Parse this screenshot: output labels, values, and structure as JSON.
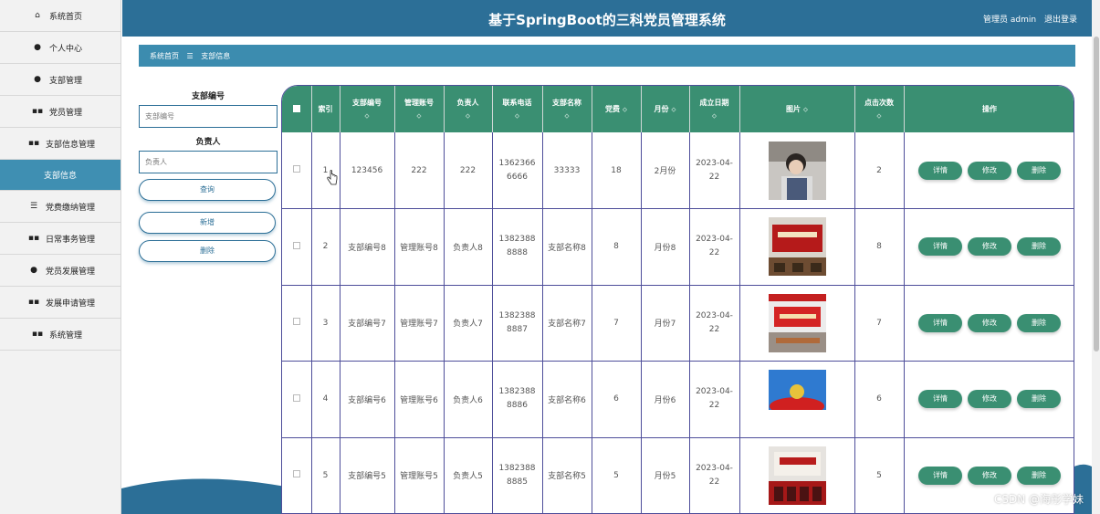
{
  "sidebar": {
    "items": [
      {
        "icon": "home-icon",
        "glyph": "⌂",
        "label": "系统首页"
      },
      {
        "icon": "user-icon",
        "glyph": "●",
        "label": "个人中心"
      },
      {
        "icon": "user-icon",
        "glyph": "●",
        "label": "支部管理"
      },
      {
        "icon": "grid-icon",
        "glyph": "▪▪",
        "label": "党员管理"
      },
      {
        "icon": "grid-icon",
        "glyph": "▪▪",
        "label": "支部信息管理"
      },
      {
        "icon": "",
        "glyph": "",
        "label": "支部信息"
      },
      {
        "icon": "list-icon",
        "glyph": "☰",
        "label": "党费缴纳管理"
      },
      {
        "icon": "grid-icon",
        "glyph": "▪▪",
        "label": "日常事务管理"
      },
      {
        "icon": "pin-icon",
        "glyph": "●",
        "label": "党员发展管理"
      },
      {
        "icon": "grid-icon",
        "glyph": "▪▪",
        "label": "发展申请管理"
      },
      {
        "icon": "grid-icon",
        "glyph": "▪▪",
        "label": "系统管理"
      }
    ]
  },
  "header": {
    "title": "基于SpringBoot的三科党员管理系统",
    "user": "管理员 admin",
    "logout": "退出登录"
  },
  "breadcrumb": {
    "home": "系统首页",
    "sep": "☰",
    "current": "支部信息"
  },
  "search": {
    "field1_label": "支部编号",
    "field1_placeholder": "支部编号",
    "field2_label": "负责人",
    "field2_placeholder": "负责人",
    "query": "查询",
    "add": "新增",
    "delete": "删除"
  },
  "table": {
    "headers": [
      "索引",
      "支部编号",
      "管理账号",
      "负责人",
      "联系电话",
      "支部名称",
      "党费",
      "月份",
      "成立日期",
      "图片",
      "点击次数",
      "操作"
    ],
    "sort_glyph": "⬦",
    "row_buttons": {
      "detail": "详情",
      "edit": "修改",
      "delete": "删除"
    },
    "rows": [
      {
        "index": "1",
        "code": "123456",
        "account": "222",
        "leader": "222",
        "phone": "1362366 6666",
        "name": "33333",
        "fee": "18",
        "month": "2月份",
        "date": "2023-04-22",
        "clicks": "2"
      },
      {
        "index": "2",
        "code": "支部编号8",
        "account": "管理账号8",
        "leader": "负责人8",
        "phone": "1382388 8888",
        "name": "支部名称8",
        "fee": "8",
        "month": "月份8",
        "date": "2023-04-22",
        "clicks": "8"
      },
      {
        "index": "3",
        "code": "支部编号7",
        "account": "管理账号7",
        "leader": "负责人7",
        "phone": "1382388 8887",
        "name": "支部名称7",
        "fee": "7",
        "month": "月份7",
        "date": "2023-04-22",
        "clicks": "7"
      },
      {
        "index": "4",
        "code": "支部编号6",
        "account": "管理账号6",
        "leader": "负责人6",
        "phone": "1382388 8886",
        "name": "支部名称6",
        "fee": "6",
        "month": "月份6",
        "date": "2023-04-22",
        "clicks": "6"
      },
      {
        "index": "5",
        "code": "支部编号5",
        "account": "管理账号5",
        "leader": "负责人5",
        "phone": "1382388 8885",
        "name": "支部名称5",
        "fee": "5",
        "month": "月份5",
        "date": "2023-04-22",
        "clicks": "5"
      }
    ]
  },
  "watermark": "CSDN @海彤学妹",
  "colors": {
    "primary": "#2c6f97",
    "accent": "#3c8caf",
    "table_head": "#3a8f72",
    "button": "#3a8f72"
  }
}
